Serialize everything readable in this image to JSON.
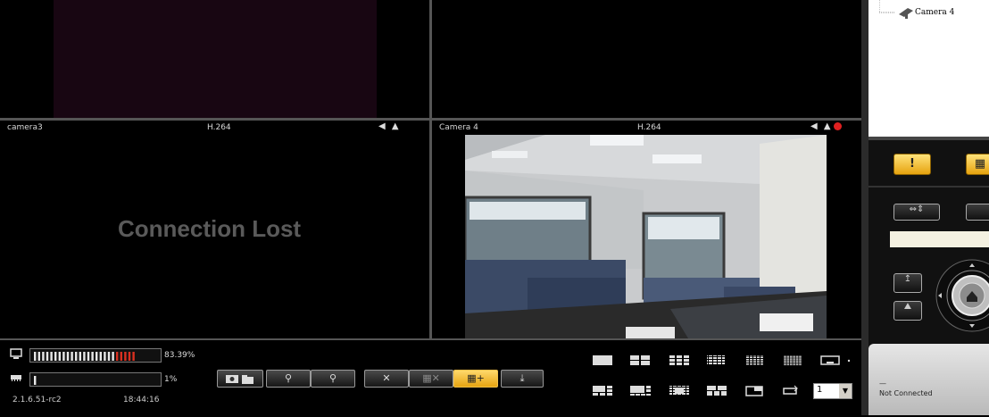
{
  "tiles": {
    "cam3": {
      "name": "camera3",
      "codec": "H.264",
      "message": "Connection Lost"
    },
    "cam4": {
      "name": "Camera 4",
      "codec": "H.264"
    }
  },
  "status": {
    "cpu_percent": "83.39%",
    "cpu_level": 0.8339,
    "mem_percent": "1%",
    "mem_level": 0.01,
    "version": "2.1.6.51-rc2",
    "time": "18:44:16"
  },
  "layout_select": {
    "value": "1"
  },
  "tree": {
    "camera_label": "Camera 4"
  },
  "ptz": {
    "status": "Not Connected",
    "status_dash": "—",
    "alarm_label": "!"
  },
  "colors": {
    "accent": "#f0b400",
    "meter_red": "#d93020",
    "separator": "#555555"
  }
}
